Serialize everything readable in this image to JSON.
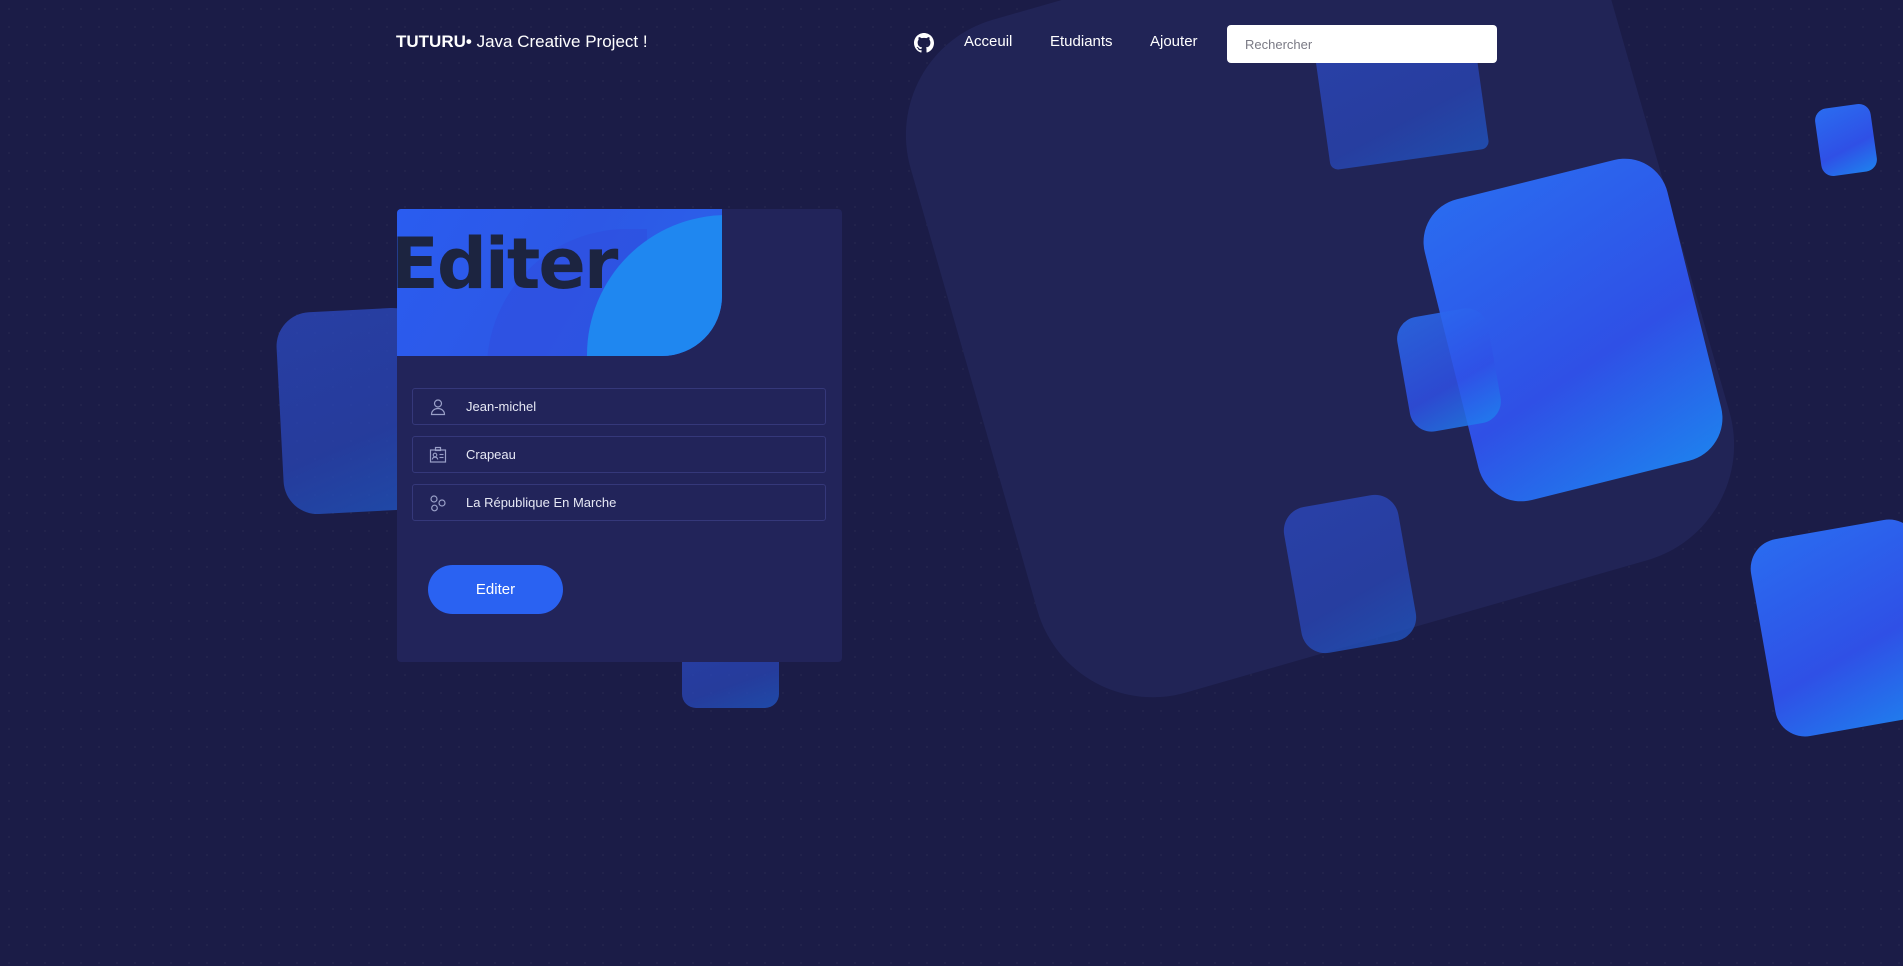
{
  "header": {
    "brand_bold": "TUTURU•",
    "brand_rest": "Java Creative Project !",
    "nav": [
      "Acceuil",
      "Etudiants",
      "Ajouter"
    ],
    "search_placeholder": "Rechercher",
    "github_icon": "github-icon"
  },
  "card": {
    "title": "Editer",
    "fields": [
      {
        "icon": "user-icon",
        "value": "Jean-michel"
      },
      {
        "icon": "id-card-icon",
        "value": "Crapeau"
      },
      {
        "icon": "molecule-icon",
        "value": "La République En Marche"
      }
    ],
    "submit_label": "Editer"
  },
  "colors": {
    "background": "#1b1c47",
    "card": "#22245a",
    "accent": "#2a62f2"
  }
}
